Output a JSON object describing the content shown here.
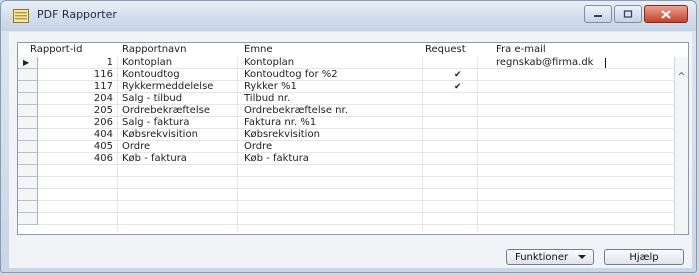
{
  "window": {
    "title": "PDF Rapporter"
  },
  "columns": {
    "id": "Rapport-id",
    "name": "Rapportnavn",
    "subject": "Emne",
    "request": "Request",
    "from": "Fra e-mail"
  },
  "rows": [
    {
      "id": "1",
      "name": "Kontoplan",
      "subject": "Kontoplan",
      "request": "",
      "from": "regnskab@firma.dk"
    },
    {
      "id": "116",
      "name": "Kontoudtog",
      "subject": "Kontoudtog for %2",
      "request": "✔",
      "from": ""
    },
    {
      "id": "117",
      "name": "Rykkermeddelelse",
      "subject": "Rykker %1",
      "request": "✔",
      "from": ""
    },
    {
      "id": "204",
      "name": "Salg - tilbud",
      "subject": "Tilbud nr.",
      "request": "",
      "from": ""
    },
    {
      "id": "205",
      "name": "Ordrebekræftelse",
      "subject": "Ordrebekræftelse nr.",
      "request": "",
      "from": ""
    },
    {
      "id": "206",
      "name": "Salg - faktura",
      "subject": "Faktura nr. %1",
      "request": "",
      "from": ""
    },
    {
      "id": "404",
      "name": "Købsrekvisition",
      "subject": "Købsrekvisition",
      "request": "",
      "from": ""
    },
    {
      "id": "405",
      "name": "Ordre",
      "subject": "Ordre",
      "request": "",
      "from": ""
    },
    {
      "id": "406",
      "name": "Køb - faktura",
      "subject": "Køb - faktura",
      "request": "",
      "from": ""
    }
  ],
  "current_row_marker": "▶",
  "buttons": {
    "functions": "Funktioner",
    "help": "Hjælp"
  }
}
